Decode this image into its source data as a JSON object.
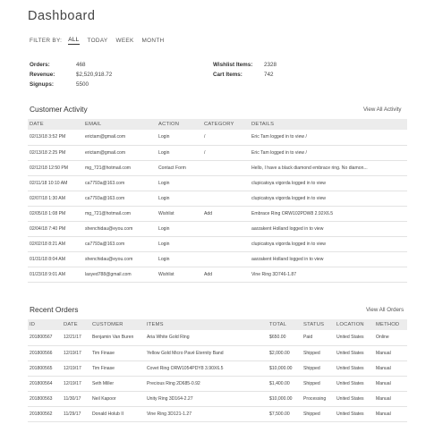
{
  "page": {
    "title": "Dashboard"
  },
  "filter": {
    "label": "FILTER BY:",
    "options": [
      "ALL",
      "TODAY",
      "WEEK",
      "MONTH"
    ],
    "active": "ALL"
  },
  "stats": {
    "orders_label": "Orders:",
    "orders_value": "468",
    "revenue_label": "Revenue:",
    "revenue_value": "$2,520,918.72",
    "signups_label": "Signups:",
    "signups_value": "5500",
    "wishlist_label": "Wishlist Items:",
    "wishlist_value": "2328",
    "cart_label": "Cart Items:",
    "cart_value": "742"
  },
  "activity": {
    "title": "Customer Activity",
    "view_all": "View All Activity",
    "columns": [
      "DATE",
      "EMAIL",
      "ACTION",
      "CATEGORY",
      "DETAILS"
    ],
    "rows": [
      [
        "02/13/18 3:52 PM",
        "erictam@gmail.com",
        "Login",
        "/",
        "Eric Tam logged in to view /"
      ],
      [
        "02/13/18 2:25 PM",
        "erictam@gmail.com",
        "Login",
        "/",
        "Eric Tam logged in to view /"
      ],
      [
        "02/12/18 12:50 PM",
        "mg_721@hotmail.com",
        "Contact Form",
        "",
        "Hello, I have a black diamond embrace ring. No diamon..."
      ],
      [
        "02/11/18 10:10 AM",
        "ca7793a@163.com",
        "Login",
        "",
        "clupicatoya vigorda logged in to view"
      ],
      [
        "02/07/18 1:30 AM",
        "ca7793a@163.com",
        "Login",
        "",
        "clupicatoya vigorda logged in to view"
      ],
      [
        "02/05/18 1:08 PM",
        "mg_721@hotmail.com",
        "Wishlist",
        "Add",
        "Embrace Ring ORW102PDW8 2.92X6.5"
      ],
      [
        "02/04/18 7:40 PM",
        "shenchidau@eyou.com",
        "Login",
        "",
        "aarzakent Holland logged in to view"
      ],
      [
        "02/02/18 8:21 AM",
        "ca7793a@163.com",
        "Login",
        "",
        "clupicatoya vigorda logged in to view"
      ],
      [
        "01/31/18 8:04 AM",
        "shenchidau@eyou.com",
        "Login",
        "",
        "aarzakent Holland logged in to view"
      ],
      [
        "01/23/18 9:01 AM",
        "lasyed788@gmail.com",
        "Wishlist",
        "Add",
        "Vine Ring 3D746-1.87"
      ]
    ]
  },
  "orders": {
    "title": "Recent Orders",
    "view_all": "View All Orders",
    "columns": [
      "ID",
      "DATE",
      "CUSTOMER",
      "ITEMS",
      "TOTAL",
      "STATUS",
      "LOCATION",
      "METHOD"
    ],
    "rows": [
      [
        "201800567",
        "12/21/17",
        "Benjamin Van Buren",
        "Aria White Gold Ring",
        "$650.00",
        "Paid",
        "United States",
        "Online"
      ],
      [
        "201800566",
        "12/19/17",
        "Tim Finase",
        "Yellow Gold Micro Pavé Eternity Band",
        "$2,000.00",
        "Shipped",
        "United States",
        "Manual"
      ],
      [
        "201800565",
        "12/19/17",
        "Tim Finase",
        "Covet Ring ORW1054PDY8 3.90X6.5",
        "$10,000.00",
        "Shipped",
        "United States",
        "Manual"
      ],
      [
        "201800564",
        "12/19/17",
        "Seth Miller",
        "Precious Ring 2D685-0.92",
        "$1,400.00",
        "Shipped",
        "United States",
        "Manual"
      ],
      [
        "201800563",
        "11/30/17",
        "Neil Kapoor",
        "Unity Ring 3D164-2.27",
        "$10,000.00",
        "Processing",
        "United States",
        "Manual"
      ],
      [
        "201800562",
        "11/29/17",
        "Donald Holub II",
        "Vine Ring 3D121-1.27",
        "$7,500.00",
        "Shipped",
        "United States",
        "Manual"
      ]
    ]
  }
}
